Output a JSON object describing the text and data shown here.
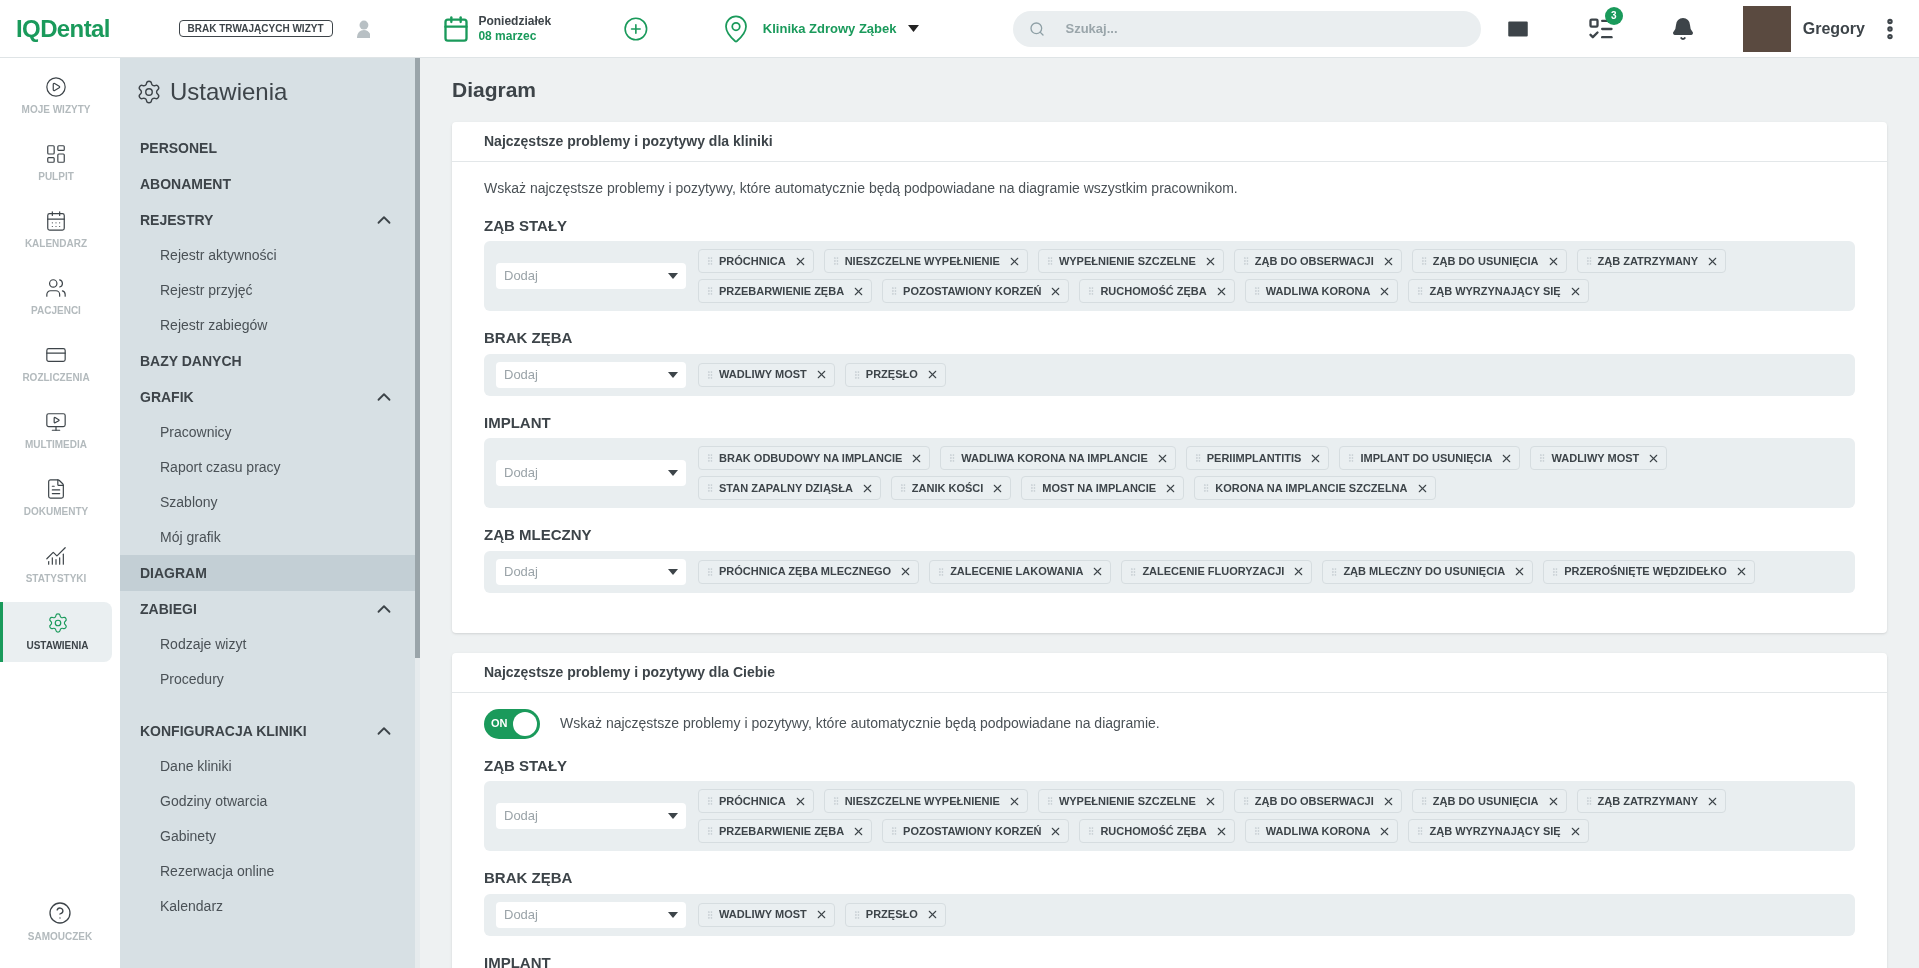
{
  "topbar": {
    "logo": "IQDental",
    "visit_status": "BRAK TRWAJĄCYCH WIZYT",
    "date": {
      "day": "Poniedziałek",
      "date": "08 marzec"
    },
    "clinic": "Klinika Zdrowy Ząbek",
    "search": {
      "placeholder": "Szukaj..."
    },
    "tasks_badge": "3",
    "user": "Gregory"
  },
  "nav": [
    {
      "label": "MOJE WIZYTY",
      "selected": false
    },
    {
      "label": "PULPIT",
      "selected": false
    },
    {
      "label": "KALENDARZ",
      "selected": false
    },
    {
      "label": "PACJENCI",
      "selected": false
    },
    {
      "label": "ROZLICZENIA",
      "selected": false
    },
    {
      "label": "MULTIMEDIA",
      "selected": false
    },
    {
      "label": "DOKUMENTY",
      "selected": false
    },
    {
      "label": "STATYSTYKI",
      "selected": false
    },
    {
      "label": "USTAWIENIA",
      "selected": true
    }
  ],
  "nav_bottom": {
    "label": "SAMOUCZEK"
  },
  "settings": {
    "title": "Ustawienia",
    "sections": [
      {
        "kind": "link",
        "label": "PERSONEL",
        "selected": false
      },
      {
        "kind": "link",
        "label": "ABONAMENT",
        "selected": false
      },
      {
        "kind": "group",
        "label": "REJESTRY",
        "selected": false,
        "expanded": true,
        "children": [
          "Rejestr aktywności",
          "Rejestr przyjęć",
          "Rejestr zabiegów"
        ]
      },
      {
        "kind": "link",
        "label": "BAZY DANYCH",
        "selected": false
      },
      {
        "kind": "group",
        "label": "GRAFIK",
        "selected": false,
        "expanded": true,
        "children": [
          "Pracownicy",
          "Raport czasu pracy",
          "Szablony",
          "Mój grafik"
        ]
      },
      {
        "kind": "link",
        "label": "DIAGRAM",
        "selected": true
      },
      {
        "kind": "group",
        "label": "ZABIEGI",
        "selected": false,
        "expanded": true,
        "children": [
          "Rodzaje wizyt",
          "Procedury"
        ]
      },
      {
        "kind": "group",
        "label": "KONFIGURACJA KLINIKI",
        "selected": false,
        "expanded": true,
        "children": [
          "Dane kliniki",
          "Godziny otwarcia",
          "Gabinety",
          "Rezerwacja online",
          "Kalendarz"
        ]
      }
    ]
  },
  "page_title": "Diagram",
  "cards": [
    {
      "title": "Najczęstsze problemy i pozytywy dla kliniki",
      "description": "Wskaż najczęstsze problemy i pozytywy, które automatycznie będą podpowiadane na diagramie wszystkim pracownikom.",
      "groups": [
        {
          "label": "ZĄB STAŁY",
          "placeholder": "Dodaj",
          "tags": [
            "PRÓCHNICA",
            "NIESZCZELNE WYPEŁNIENIE",
            "WYPEŁNIENIE SZCZELNE",
            "ZĄB DO OBSERWACJI",
            "ZĄB DO USUNIĘCIA",
            "ZĄB ZATRZYMANY",
            "PRZEBARWIENIE ZĘBA",
            "POZOSTAWIONY KORZEŃ",
            "RUCHOMOŚĆ ZĘBA",
            "WADLIWA KORONA",
            "ZĄB WYRZYNAJĄCY SIĘ"
          ]
        },
        {
          "label": "BRAK ZĘBA",
          "placeholder": "Dodaj",
          "tags": [
            "WADLIWY MOST",
            "PRZĘSŁO"
          ]
        },
        {
          "label": "IMPLANT",
          "placeholder": "Dodaj",
          "tags": [
            "BRAK ODBUDOWY NA IMPLANCIE",
            "WADLIWA KORONA NA IMPLANCIE",
            "PERIIMPLANTITIS",
            "IMPLANT DO USUNIĘCIA",
            "WADLIWY MOST",
            "STAN ZAPALNY DZIĄSŁA",
            "ZANIK KOŚCI",
            "MOST NA IMPLANCIE",
            "KORONA NA IMPLANCIE SZCZELNA"
          ]
        },
        {
          "label": "ZĄB MLECZNY",
          "placeholder": "Dodaj",
          "tags": [
            "PRÓCHNICA ZĘBA MLECZNEGO",
            "ZALECENIE LAKOWANIA",
            "ZALECENIE FLUORYZACJI",
            "ZĄB MLECZNY DO USUNIĘCIA",
            "PRZEROŚNIĘTE WĘDZIDEŁKO"
          ]
        }
      ]
    },
    {
      "title": "Najczęstsze problemy i pozytywy dla Ciebie",
      "toggle": {
        "on": true,
        "label": "ON"
      },
      "description": "Wskaż najczęstsze problemy i pozytywy, które automatycznie będą podpowiadane na diagramie.",
      "groups": [
        {
          "label": "ZĄB STAŁY",
          "placeholder": "Dodaj",
          "tags": [
            "PRÓCHNICA",
            "NIESZCZELNE WYPEŁNIENIE",
            "WYPEŁNIENIE SZCZELNE",
            "ZĄB DO OBSERWACJI",
            "ZĄB DO USUNIĘCIA",
            "ZĄB ZATRZYMANY",
            "PRZEBARWIENIE ZĘBA",
            "POZOSTAWIONY KORZEŃ",
            "RUCHOMOŚĆ ZĘBA",
            "WADLIWA KORONA",
            "ZĄB WYRZYNAJĄCY SIĘ"
          ]
        },
        {
          "label": "BRAK ZĘBA",
          "placeholder": "Dodaj",
          "tags": [
            "WADLIWY MOST",
            "PRZĘSŁO"
          ]
        },
        {
          "label": "IMPLANT"
        }
      ]
    }
  ]
}
